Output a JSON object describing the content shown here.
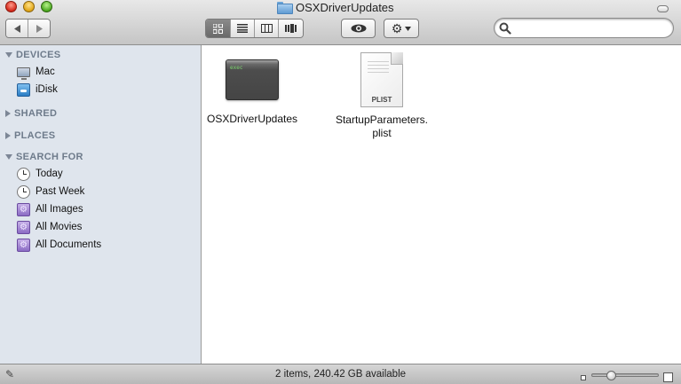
{
  "window": {
    "title": "OSXDriverUpdates",
    "title_icon": "folder-icon"
  },
  "toolbar": {
    "back_icon": "back-arrow-icon",
    "forward_icon": "forward-arrow-icon",
    "view_modes": [
      {
        "name": "icon-view",
        "glyph": "▦",
        "active": true
      },
      {
        "name": "list-view",
        "glyph": "≡",
        "active": false
      },
      {
        "name": "column-view",
        "glyph": "║",
        "active": false
      },
      {
        "name": "coverflow-view",
        "glyph": "▐",
        "active": false
      }
    ],
    "quicklook_icon": "eye-icon",
    "action_icon": "gear-icon",
    "search_placeholder": ""
  },
  "sidebar": {
    "sections": [
      {
        "label": "DEVICES",
        "expanded": true
      },
      {
        "label": "SHARED",
        "expanded": false
      },
      {
        "label": "PLACES",
        "expanded": false
      },
      {
        "label": "SEARCH FOR",
        "expanded": true
      }
    ],
    "devices": [
      {
        "label": "Mac",
        "icon": "computer-icon"
      },
      {
        "label": "iDisk",
        "icon": "idisk-icon"
      }
    ],
    "search_for": [
      {
        "label": "Today",
        "icon": "clock-icon"
      },
      {
        "label": "Past Week",
        "icon": "clock-icon"
      },
      {
        "label": "All Images",
        "icon": "smart-folder-icon"
      },
      {
        "label": "All Movies",
        "icon": "smart-folder-icon"
      },
      {
        "label": "All Documents",
        "icon": "smart-folder-icon"
      }
    ]
  },
  "files": [
    {
      "name": "OSXDriverUpdates",
      "kind": "executable",
      "icon_label": "exec"
    },
    {
      "name_line1": "StartupParameters.",
      "name_line2": "plist",
      "kind": "plist",
      "icon_label": "PLIST"
    }
  ],
  "status": {
    "text": "2 items, 240.42 GB available",
    "zoom_level": 0.25
  }
}
